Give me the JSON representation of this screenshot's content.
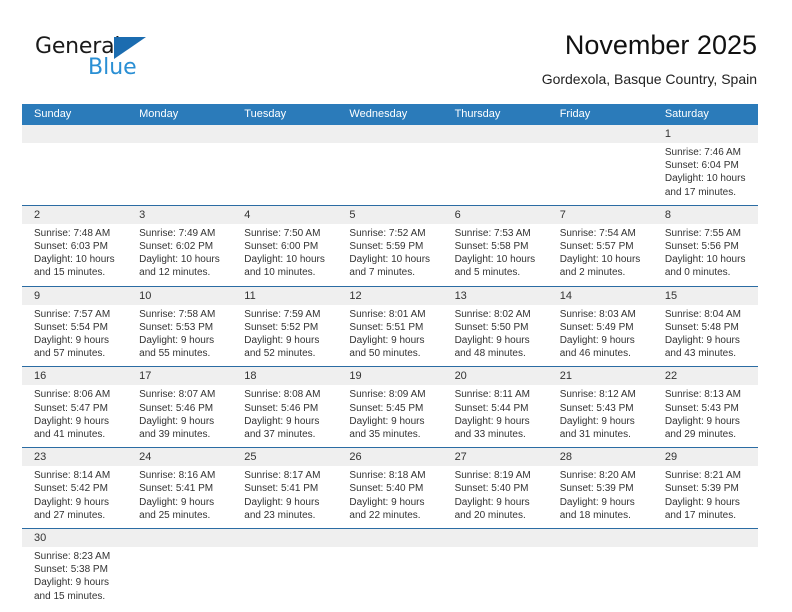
{
  "brand": {
    "name_top": "General",
    "name_bottom": "Blue",
    "flag_color": "#1b6cb0",
    "blue_color": "#2a8fd4"
  },
  "header": {
    "title": "November 2025",
    "subtitle": "Gordexola, Basque Country, Spain"
  },
  "theme": {
    "header_bg": "#2b7bba",
    "header_text": "#ffffff",
    "date_band_bg": "#efefef",
    "row_rule": "#2b6ca3",
    "body_text": "#333333"
  },
  "weekdays": [
    "Sunday",
    "Monday",
    "Tuesday",
    "Wednesday",
    "Thursday",
    "Friday",
    "Saturday"
  ],
  "weeks": [
    [
      {
        "date": "",
        "lines": []
      },
      {
        "date": "",
        "lines": []
      },
      {
        "date": "",
        "lines": []
      },
      {
        "date": "",
        "lines": []
      },
      {
        "date": "",
        "lines": []
      },
      {
        "date": "",
        "lines": []
      },
      {
        "date": "1",
        "lines": [
          "Sunrise: 7:46 AM",
          "Sunset: 6:04 PM",
          "Daylight: 10 hours",
          "and 17 minutes."
        ]
      }
    ],
    [
      {
        "date": "2",
        "lines": [
          "Sunrise: 7:48 AM",
          "Sunset: 6:03 PM",
          "Daylight: 10 hours",
          "and 15 minutes."
        ]
      },
      {
        "date": "3",
        "lines": [
          "Sunrise: 7:49 AM",
          "Sunset: 6:02 PM",
          "Daylight: 10 hours",
          "and 12 minutes."
        ]
      },
      {
        "date": "4",
        "lines": [
          "Sunrise: 7:50 AM",
          "Sunset: 6:00 PM",
          "Daylight: 10 hours",
          "and 10 minutes."
        ]
      },
      {
        "date": "5",
        "lines": [
          "Sunrise: 7:52 AM",
          "Sunset: 5:59 PM",
          "Daylight: 10 hours",
          "and 7 minutes."
        ]
      },
      {
        "date": "6",
        "lines": [
          "Sunrise: 7:53 AM",
          "Sunset: 5:58 PM",
          "Daylight: 10 hours",
          "and 5 minutes."
        ]
      },
      {
        "date": "7",
        "lines": [
          "Sunrise: 7:54 AM",
          "Sunset: 5:57 PM",
          "Daylight: 10 hours",
          "and 2 minutes."
        ]
      },
      {
        "date": "8",
        "lines": [
          "Sunrise: 7:55 AM",
          "Sunset: 5:56 PM",
          "Daylight: 10 hours",
          "and 0 minutes."
        ]
      }
    ],
    [
      {
        "date": "9",
        "lines": [
          "Sunrise: 7:57 AM",
          "Sunset: 5:54 PM",
          "Daylight: 9 hours",
          "and 57 minutes."
        ]
      },
      {
        "date": "10",
        "lines": [
          "Sunrise: 7:58 AM",
          "Sunset: 5:53 PM",
          "Daylight: 9 hours",
          "and 55 minutes."
        ]
      },
      {
        "date": "11",
        "lines": [
          "Sunrise: 7:59 AM",
          "Sunset: 5:52 PM",
          "Daylight: 9 hours",
          "and 52 minutes."
        ]
      },
      {
        "date": "12",
        "lines": [
          "Sunrise: 8:01 AM",
          "Sunset: 5:51 PM",
          "Daylight: 9 hours",
          "and 50 minutes."
        ]
      },
      {
        "date": "13",
        "lines": [
          "Sunrise: 8:02 AM",
          "Sunset: 5:50 PM",
          "Daylight: 9 hours",
          "and 48 minutes."
        ]
      },
      {
        "date": "14",
        "lines": [
          "Sunrise: 8:03 AM",
          "Sunset: 5:49 PM",
          "Daylight: 9 hours",
          "and 46 minutes."
        ]
      },
      {
        "date": "15",
        "lines": [
          "Sunrise: 8:04 AM",
          "Sunset: 5:48 PM",
          "Daylight: 9 hours",
          "and 43 minutes."
        ]
      }
    ],
    [
      {
        "date": "16",
        "lines": [
          "Sunrise: 8:06 AM",
          "Sunset: 5:47 PM",
          "Daylight: 9 hours",
          "and 41 minutes."
        ]
      },
      {
        "date": "17",
        "lines": [
          "Sunrise: 8:07 AM",
          "Sunset: 5:46 PM",
          "Daylight: 9 hours",
          "and 39 minutes."
        ]
      },
      {
        "date": "18",
        "lines": [
          "Sunrise: 8:08 AM",
          "Sunset: 5:46 PM",
          "Daylight: 9 hours",
          "and 37 minutes."
        ]
      },
      {
        "date": "19",
        "lines": [
          "Sunrise: 8:09 AM",
          "Sunset: 5:45 PM",
          "Daylight: 9 hours",
          "and 35 minutes."
        ]
      },
      {
        "date": "20",
        "lines": [
          "Sunrise: 8:11 AM",
          "Sunset: 5:44 PM",
          "Daylight: 9 hours",
          "and 33 minutes."
        ]
      },
      {
        "date": "21",
        "lines": [
          "Sunrise: 8:12 AM",
          "Sunset: 5:43 PM",
          "Daylight: 9 hours",
          "and 31 minutes."
        ]
      },
      {
        "date": "22",
        "lines": [
          "Sunrise: 8:13 AM",
          "Sunset: 5:43 PM",
          "Daylight: 9 hours",
          "and 29 minutes."
        ]
      }
    ],
    [
      {
        "date": "23",
        "lines": [
          "Sunrise: 8:14 AM",
          "Sunset: 5:42 PM",
          "Daylight: 9 hours",
          "and 27 minutes."
        ]
      },
      {
        "date": "24",
        "lines": [
          "Sunrise: 8:16 AM",
          "Sunset: 5:41 PM",
          "Daylight: 9 hours",
          "and 25 minutes."
        ]
      },
      {
        "date": "25",
        "lines": [
          "Sunrise: 8:17 AM",
          "Sunset: 5:41 PM",
          "Daylight: 9 hours",
          "and 23 minutes."
        ]
      },
      {
        "date": "26",
        "lines": [
          "Sunrise: 8:18 AM",
          "Sunset: 5:40 PM",
          "Daylight: 9 hours",
          "and 22 minutes."
        ]
      },
      {
        "date": "27",
        "lines": [
          "Sunrise: 8:19 AM",
          "Sunset: 5:40 PM",
          "Daylight: 9 hours",
          "and 20 minutes."
        ]
      },
      {
        "date": "28",
        "lines": [
          "Sunrise: 8:20 AM",
          "Sunset: 5:39 PM",
          "Daylight: 9 hours",
          "and 18 minutes."
        ]
      },
      {
        "date": "29",
        "lines": [
          "Sunrise: 8:21 AM",
          "Sunset: 5:39 PM",
          "Daylight: 9 hours",
          "and 17 minutes."
        ]
      }
    ],
    [
      {
        "date": "30",
        "lines": [
          "Sunrise: 8:23 AM",
          "Sunset: 5:38 PM",
          "Daylight: 9 hours",
          "and 15 minutes."
        ]
      },
      {
        "date": "",
        "lines": []
      },
      {
        "date": "",
        "lines": []
      },
      {
        "date": "",
        "lines": []
      },
      {
        "date": "",
        "lines": []
      },
      {
        "date": "",
        "lines": []
      },
      {
        "date": "",
        "lines": []
      }
    ]
  ]
}
